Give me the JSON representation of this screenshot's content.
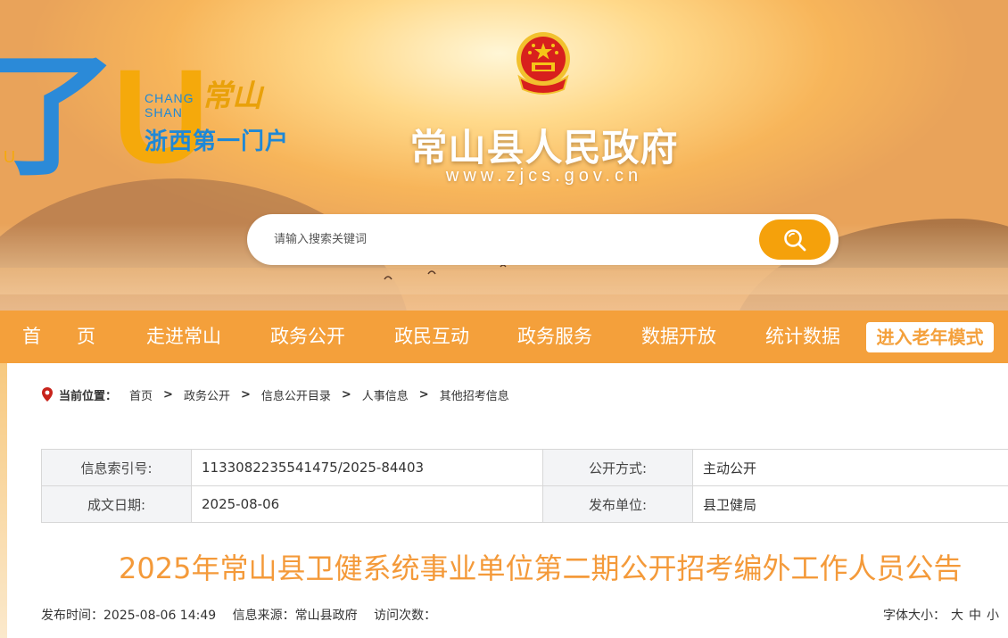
{
  "header": {
    "logo_big_a": "了",
    "logo_big_b": "U",
    "logo_small": "U",
    "logo_en_1": "CHANG",
    "logo_en_2": "SHAN",
    "logo_script": "常山",
    "logo_slogan": "浙西第一门户",
    "site_title": "常山县人民政府",
    "site_url": "www.zjcs.gov.cn"
  },
  "search": {
    "placeholder": "请输入搜索关键词"
  },
  "nav": {
    "home": "首页",
    "items": [
      "走进常山",
      "政务公开",
      "政民互动",
      "政务服务",
      "数据开放",
      "统计数据"
    ],
    "elder_mode": "进入老年模式"
  },
  "breadcrumb": {
    "label": "当前位置：",
    "items": [
      "首页",
      "政务公开",
      "信息公开目录",
      "人事信息",
      "其他招考信息"
    ],
    "separator": ">"
  },
  "info": {
    "index_label": "信息索引号:",
    "index_value": "1133082235541475/2025-84403",
    "method_label": "公开方式:",
    "method_value": "主动公开",
    "date_label": "成文日期:",
    "date_value": "2025-08-06",
    "unit_label": "发布单位:",
    "unit_value": "县卫健局"
  },
  "article": {
    "title": "2025年常山县卫健系统事业单位第二期公开招考编外工作人员公告",
    "publish_time": "发布时间：2025-08-06 14:49",
    "source": "信息来源：常山县政府",
    "visits": "访问次数："
  },
  "font_size": {
    "label": "字体大小：",
    "large": "大",
    "medium": "中",
    "small": "小"
  },
  "colors": {
    "accent": "#f4a03b",
    "title": "#f49a3a",
    "search_button": "#f5a10b",
    "logo_blue": "#1e88d6"
  }
}
